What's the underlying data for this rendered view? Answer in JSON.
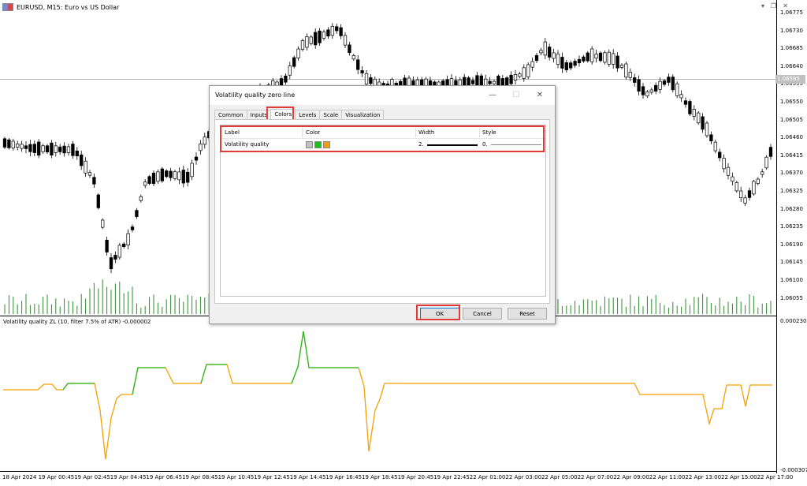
{
  "chart": {
    "symbol_title": "EURUSD, M15:  Euro vs US Dollar",
    "price_ticks": [
      "1.06775",
      "1.06730",
      "1.06685",
      "1.06640",
      "1.06595",
      "1.06550",
      "1.06505",
      "1.06460",
      "1.06415",
      "1.06370",
      "1.06325",
      "1.06280",
      "1.06235",
      "1.06190",
      "1.06145",
      "1.06100",
      "1.06055"
    ],
    "current_price": "1.06595",
    "time_ticks": [
      "18 Apr 2024",
      "19 Apr 00:45",
      "19 Apr 02:45",
      "19 Apr 04:45",
      "19 Apr 06:45",
      "19 Apr 08:45",
      "19 Apr 10:45",
      "19 Apr 12:45",
      "19 Apr 14:45",
      "19 Apr 16:45",
      "19 Apr 18:45",
      "19 Apr 20:45",
      "19 Apr 22:45",
      "22 Apr 01:00",
      "22 Apr 03:00",
      "22 Apr 05:00",
      "22 Apr 07:00",
      "22 Apr 09:00",
      "22 Apr 11:00",
      "22 Apr 13:00",
      "22 Apr 15:00",
      "22 Apr 17:00"
    ],
    "indicator_label": "Volatility quality ZL (10, filter 7.5% of ATR) -0.000002",
    "indicator_scale_top": "0.000230",
    "indicator_scale_bottom": "-0.000307",
    "colors": {
      "bull": "#000000",
      "bear": "#000000",
      "volume": "#2e8b2e",
      "up": "#22bb22",
      "down": "#f5a000"
    }
  },
  "dialog": {
    "title": "Volatility quality zero line",
    "tabs": [
      "Common",
      "Inputs",
      "Colors",
      "Levels",
      "Scale",
      "Visualization"
    ],
    "active_tab": "Colors",
    "table": {
      "headers": {
        "label": "Label",
        "color": "Color",
        "width": "Width",
        "style": "Style"
      },
      "row": {
        "label": "Volatility quality",
        "colors": [
          "#c0c0c0",
          "#22bb22",
          "#f5a000"
        ],
        "width": "2.",
        "style": "0."
      }
    },
    "buttons": {
      "ok": "OK",
      "cancel": "Cancel",
      "reset": "Reset"
    }
  }
}
